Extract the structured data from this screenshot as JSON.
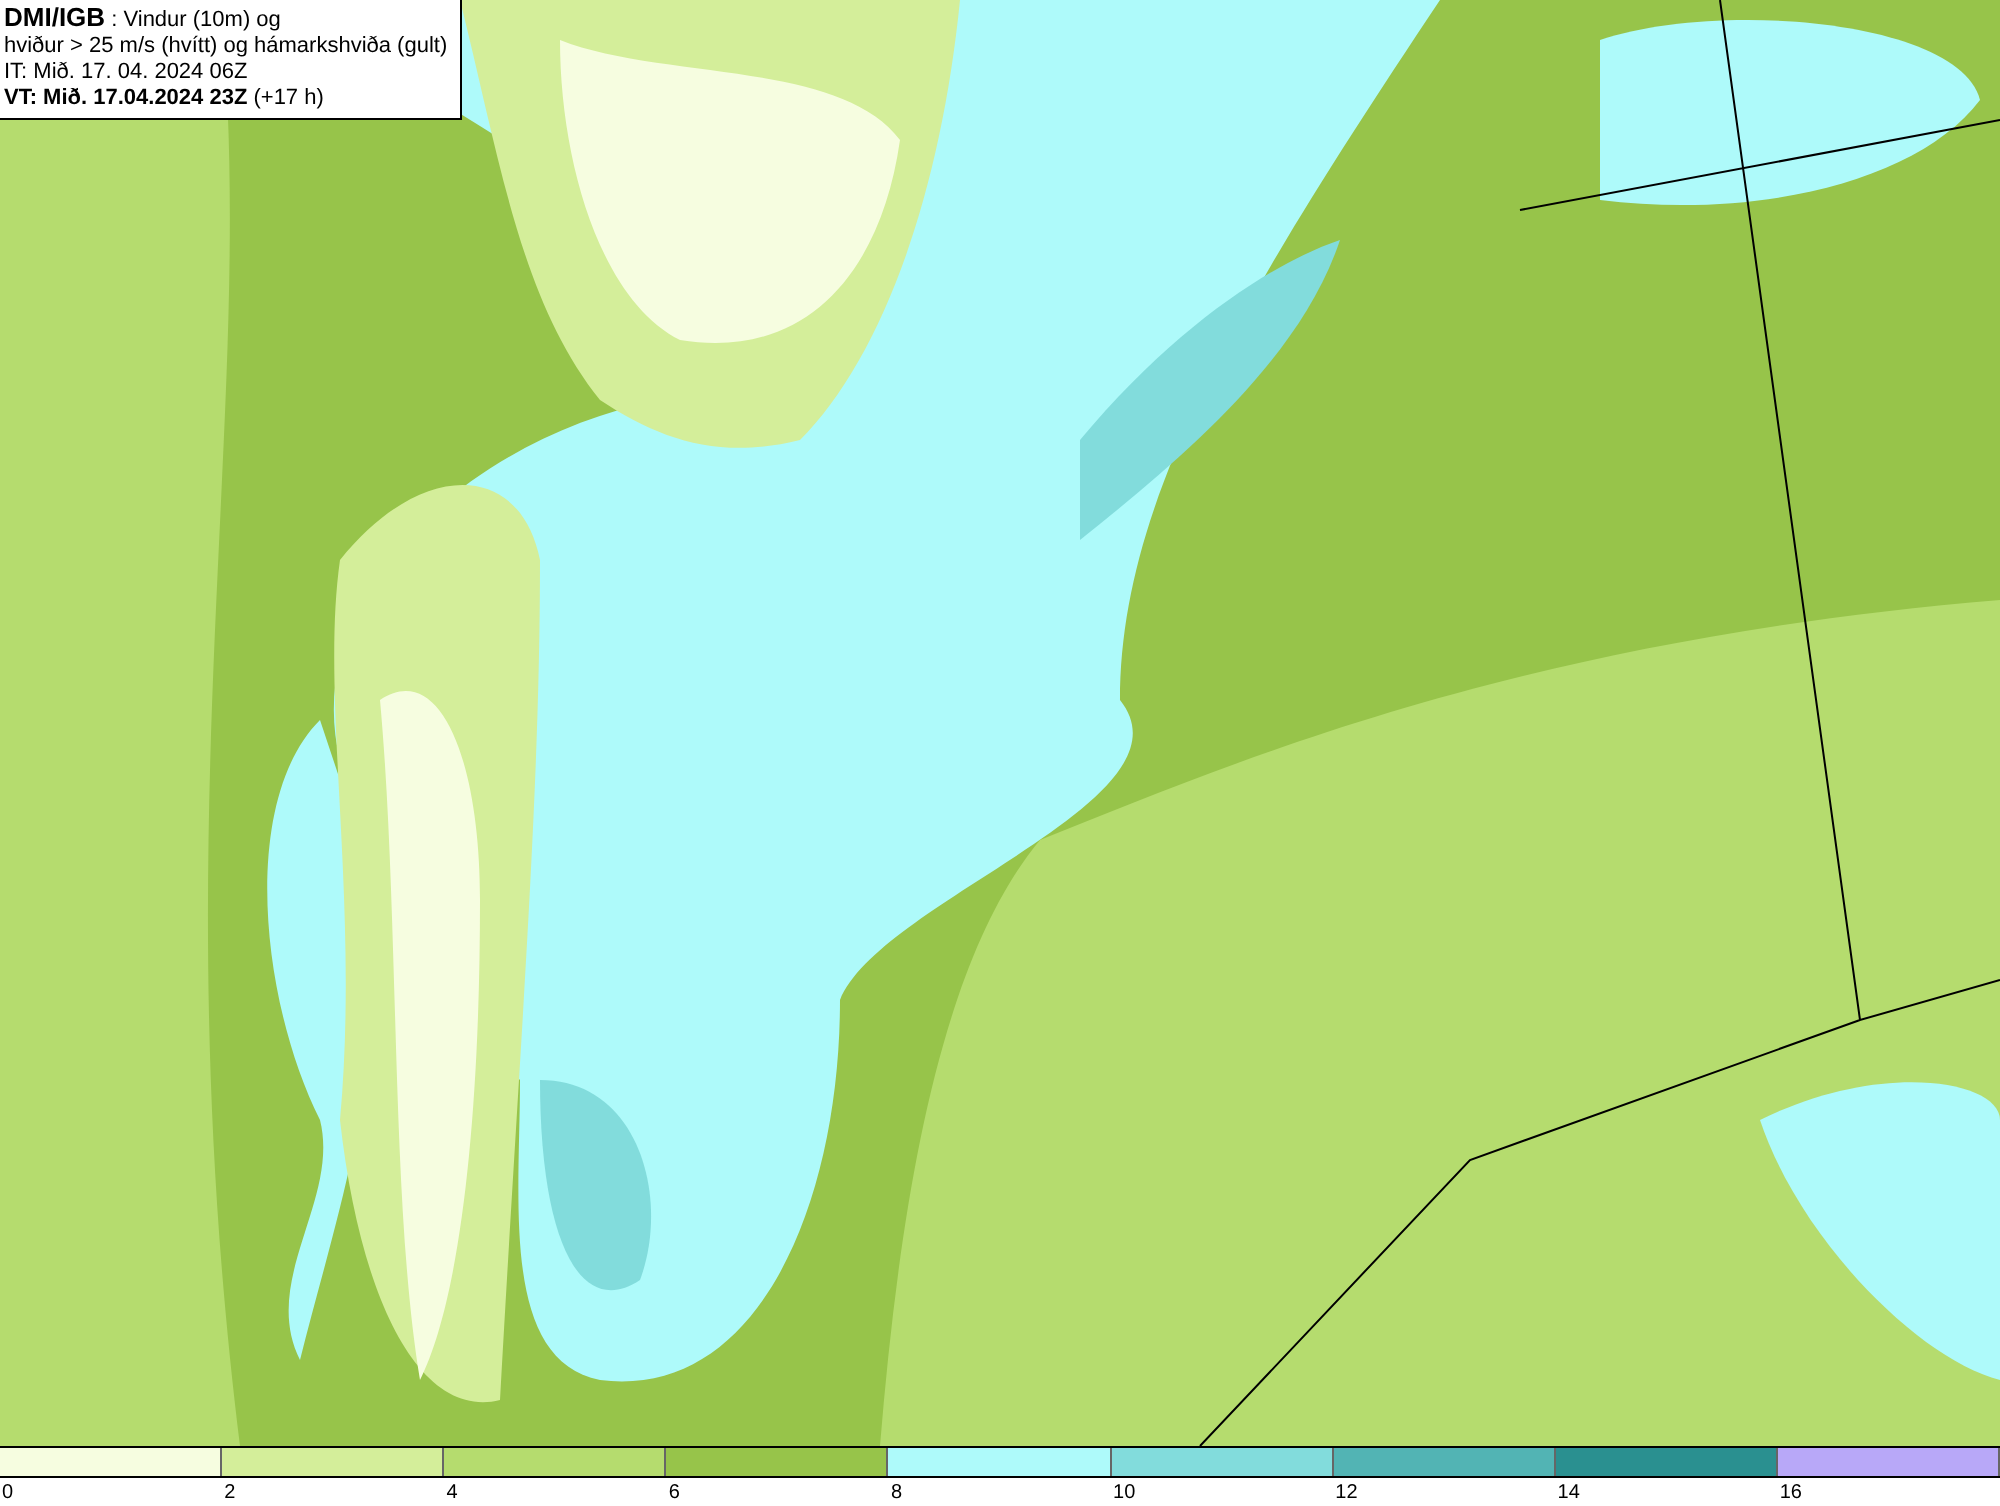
{
  "legend": {
    "lines": [
      "**DMI/IGB** : Vindur (10m) og",
      "hviður > 25 m/s (hvítt) og hámarkshviða (gult)",
      "IT: Mið. 17. 04. 2024 06Z",
      "**VT: Mið. 17.04.2024 23Z** (+17 h)"
    ]
  },
  "colorbar": {
    "segments": [
      {
        "color": "#f6fde0",
        "label": "0"
      },
      {
        "color": "#d4ee9a",
        "label": "2"
      },
      {
        "color": "#b5dc6e",
        "label": "4"
      },
      {
        "color": "#97c44a",
        "label": "6"
      },
      {
        "color": "#aefafa",
        "label": "8"
      },
      {
        "color": "#82dcdc",
        "label": "10"
      },
      {
        "color": "#52b4b4",
        "label": "12"
      },
      {
        "color": "#2a9090",
        "label": "14"
      },
      {
        "color": "#b8a8f8",
        "label": "16"
      }
    ]
  }
}
